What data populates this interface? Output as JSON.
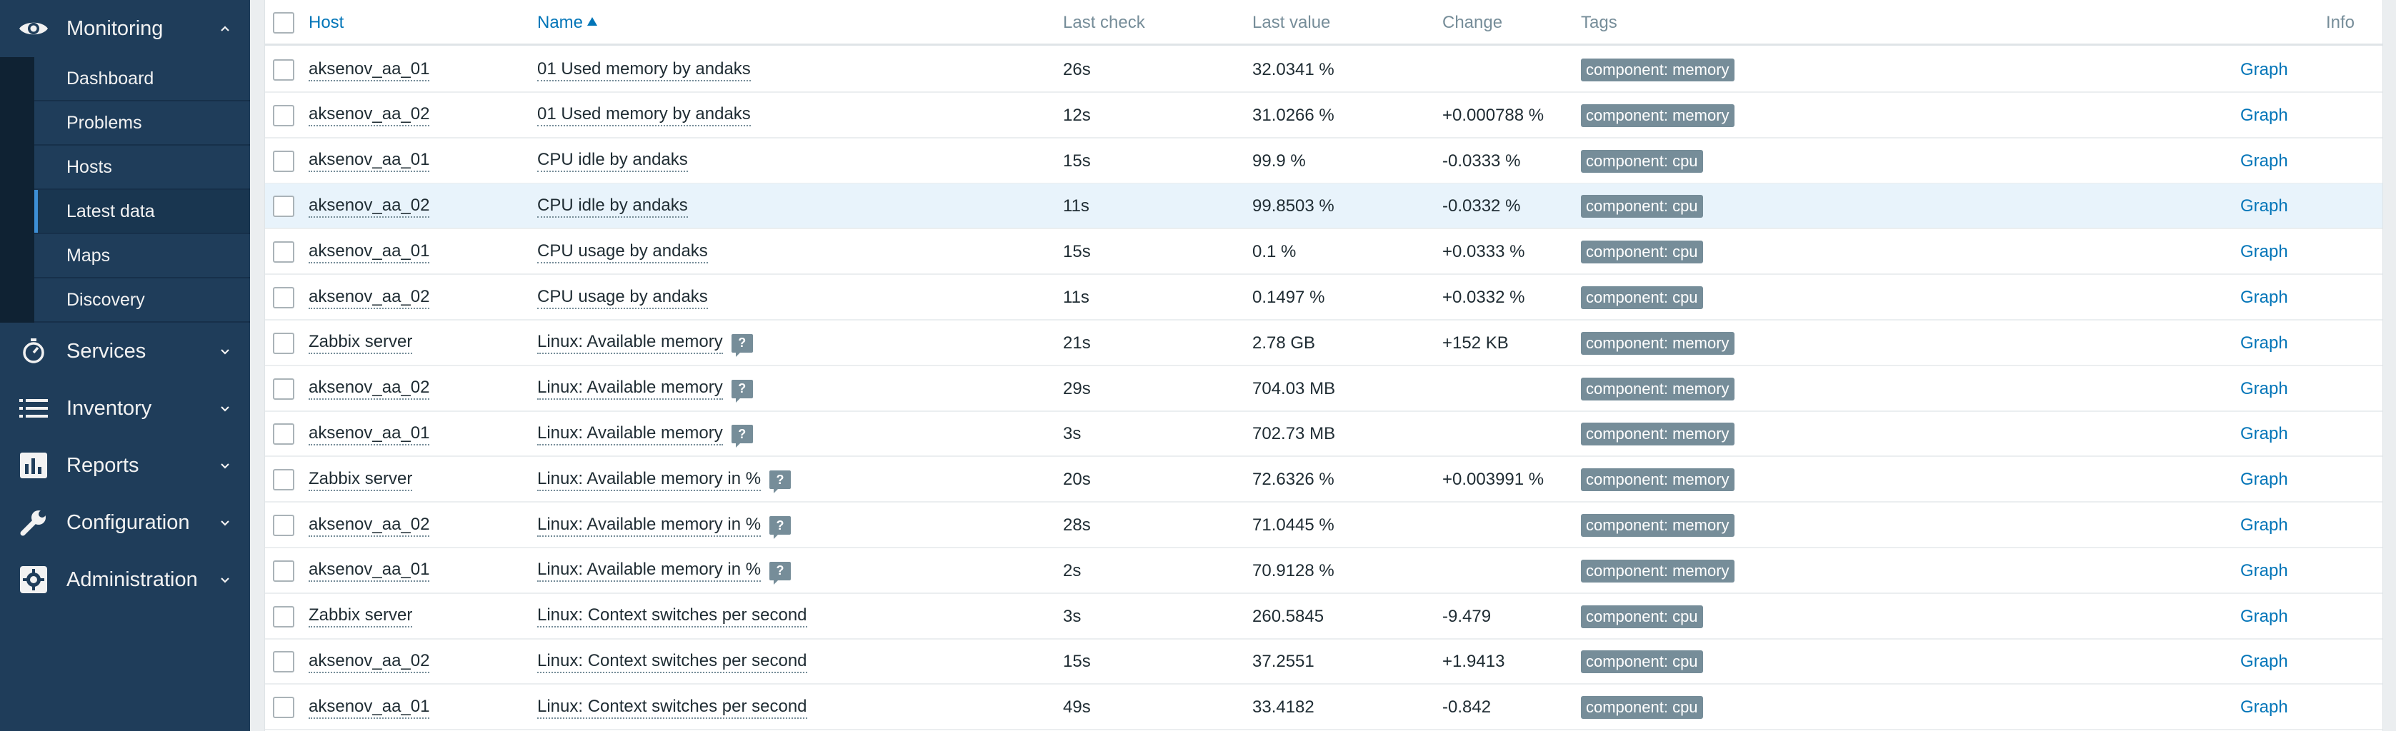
{
  "sidebar": {
    "monitoring": {
      "label": "Monitoring",
      "icon": "eye-icon"
    },
    "submenu": [
      {
        "label": "Dashboard",
        "active": false
      },
      {
        "label": "Problems",
        "active": false
      },
      {
        "label": "Hosts",
        "active": false
      },
      {
        "label": "Latest data",
        "active": true
      },
      {
        "label": "Maps",
        "active": false
      },
      {
        "label": "Discovery",
        "active": false
      }
    ],
    "sections": [
      {
        "label": "Services",
        "icon": "clock-icon"
      },
      {
        "label": "Inventory",
        "icon": "list-icon"
      },
      {
        "label": "Reports",
        "icon": "bar-chart-icon"
      },
      {
        "label": "Configuration",
        "icon": "wrench-icon"
      },
      {
        "label": "Administration",
        "icon": "gear-icon"
      }
    ]
  },
  "table": {
    "headers": {
      "host": "Host",
      "name": "Name",
      "last_check": "Last check",
      "last_value": "Last value",
      "change": "Change",
      "tags": "Tags",
      "info": "Info"
    },
    "rows": [
      {
        "host": "aksenov_aa_01",
        "name": "01 Used memory by andaks",
        "hint": false,
        "last_check": "26s",
        "last_value": "32.0341 %",
        "change": "",
        "tag": "component: memory",
        "graph": "Graph"
      },
      {
        "host": "aksenov_aa_02",
        "name": "01 Used memory by andaks",
        "hint": false,
        "last_check": "12s",
        "last_value": "31.0266 %",
        "change": "+0.000788 %",
        "tag": "component: memory",
        "graph": "Graph"
      },
      {
        "host": "aksenov_aa_01",
        "name": "CPU idle by andaks",
        "hint": false,
        "last_check": "15s",
        "last_value": "99.9 %",
        "change": "-0.0333 %",
        "tag": "component: cpu",
        "graph": "Graph"
      },
      {
        "host": "aksenov_aa_02",
        "name": "CPU idle by andaks",
        "hint": false,
        "last_check": "11s",
        "last_value": "99.8503 %",
        "change": "-0.0332 %",
        "tag": "component: cpu",
        "graph": "Graph",
        "highlight": true
      },
      {
        "host": "aksenov_aa_01",
        "name": "CPU usage by andaks",
        "hint": false,
        "last_check": "15s",
        "last_value": "0.1 %",
        "change": "+0.0333 %",
        "tag": "component: cpu",
        "graph": "Graph"
      },
      {
        "host": "aksenov_aa_02",
        "name": "CPU usage by andaks",
        "hint": false,
        "last_check": "11s",
        "last_value": "0.1497 %",
        "change": "+0.0332 %",
        "tag": "component: cpu",
        "graph": "Graph"
      },
      {
        "host": "Zabbix server",
        "name": "Linux: Available memory",
        "hint": true,
        "last_check": "21s",
        "last_value": "2.78 GB",
        "change": "+152 KB",
        "tag": "component: memory",
        "graph": "Graph"
      },
      {
        "host": "aksenov_aa_02",
        "name": "Linux: Available memory",
        "hint": true,
        "last_check": "29s",
        "last_value": "704.03 MB",
        "change": "",
        "tag": "component: memory",
        "graph": "Graph"
      },
      {
        "host": "aksenov_aa_01",
        "name": "Linux: Available memory",
        "hint": true,
        "last_check": "3s",
        "last_value": "702.73 MB",
        "change": "",
        "tag": "component: memory",
        "graph": "Graph"
      },
      {
        "host": "Zabbix server",
        "name": "Linux: Available memory in %",
        "hint": true,
        "last_check": "20s",
        "last_value": "72.6326 %",
        "change": "+0.003991 %",
        "tag": "component: memory",
        "graph": "Graph"
      },
      {
        "host": "aksenov_aa_02",
        "name": "Linux: Available memory in %",
        "hint": true,
        "last_check": "28s",
        "last_value": "71.0445 %",
        "change": "",
        "tag": "component: memory",
        "graph": "Graph"
      },
      {
        "host": "aksenov_aa_01",
        "name": "Linux: Available memory in %",
        "hint": true,
        "last_check": "2s",
        "last_value": "70.9128 %",
        "change": "",
        "tag": "component: memory",
        "graph": "Graph"
      },
      {
        "host": "Zabbix server",
        "name": "Linux: Context switches per second",
        "hint": false,
        "last_check": "3s",
        "last_value": "260.5845",
        "change": "-9.479",
        "tag": "component: cpu",
        "graph": "Graph"
      },
      {
        "host": "aksenov_aa_02",
        "name": "Linux: Context switches per second",
        "hint": false,
        "last_check": "15s",
        "last_value": "37.2551",
        "change": "+1.9413",
        "tag": "component: cpu",
        "graph": "Graph"
      },
      {
        "host": "aksenov_aa_01",
        "name": "Linux: Context switches per second",
        "hint": false,
        "last_check": "49s",
        "last_value": "33.4182",
        "change": "-0.842",
        "tag": "component: cpu",
        "graph": "Graph"
      }
    ]
  }
}
